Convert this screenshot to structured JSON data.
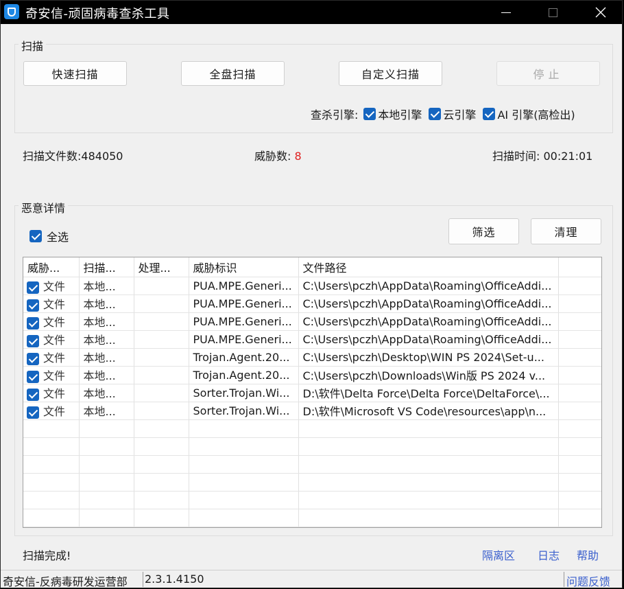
{
  "window": {
    "title": "奇安信-顽固病毒查杀工具",
    "controls": {
      "minimize_icon": "minimize-icon",
      "maximize_icon": "maximize-icon",
      "close_icon": "close-icon"
    }
  },
  "scan_group": {
    "label": "扫描",
    "buttons": {
      "quick": "快速扫描",
      "full": "全盘扫描",
      "custom": "自定义扫描",
      "stop": "停止"
    },
    "engines": {
      "label": "查杀引擎:",
      "local": "本地引擎",
      "cloud": "云引擎",
      "ai": "AI 引擎(高检出)"
    }
  },
  "stats": {
    "files_label": "扫描文件数:",
    "files_value": "484050",
    "threats_label": "威胁数:",
    "threats_value": "8",
    "time_label": "扫描时间:",
    "time_value": "00:21:01"
  },
  "detail_group": {
    "label": "恶意详情",
    "select_all": "全选",
    "filter_button": "筛选",
    "clean_button": "清理"
  },
  "table": {
    "columns": [
      "威胁...",
      "扫描...",
      "处理...",
      "威胁标识",
      "文件路径"
    ],
    "rows": [
      {
        "type": "文件",
        "engine": "本地...",
        "action": "",
        "threat": "PUA.MPE.Generi...",
        "path": "C:\\Users\\pczh\\AppData\\Roaming\\OfficeAddi..."
      },
      {
        "type": "文件",
        "engine": "本地...",
        "action": "",
        "threat": "PUA.MPE.Generi...",
        "path": "C:\\Users\\pczh\\AppData\\Roaming\\OfficeAddi..."
      },
      {
        "type": "文件",
        "engine": "本地...",
        "action": "",
        "threat": "PUA.MPE.Generi...",
        "path": "C:\\Users\\pczh\\AppData\\Roaming\\OfficeAddi..."
      },
      {
        "type": "文件",
        "engine": "本地...",
        "action": "",
        "threat": "PUA.MPE.Generi...",
        "path": "C:\\Users\\pczh\\AppData\\Roaming\\OfficeAddi..."
      },
      {
        "type": "文件",
        "engine": "本地...",
        "action": "",
        "threat": "Trojan.Agent.20...",
        "path": "C:\\Users\\pczh\\Desktop\\WIN PS 2024\\Set-u..."
      },
      {
        "type": "文件",
        "engine": "本地...",
        "action": "",
        "threat": "Trojan.Agent.20...",
        "path": "C:\\Users\\pczh\\Downloads\\Win版 PS 2024 v..."
      },
      {
        "type": "文件",
        "engine": "本地...",
        "action": "",
        "threat": "Sorter.Trojan.Wi...",
        "path": "D:\\软件\\Delta Force\\Delta Force\\DeltaForce\\..."
      },
      {
        "type": "文件",
        "engine": "本地...",
        "action": "",
        "threat": "Sorter.Trojan.Wi...",
        "path": "D:\\软件\\Microsoft VS Code\\resources\\app\\n..."
      }
    ]
  },
  "footer": {
    "status": "扫描完成!",
    "links": {
      "quarantine": "隔离区",
      "log": "日志",
      "help": "帮助"
    }
  },
  "statusbar": {
    "org": "奇安信-反病毒研发运营部",
    "version": "2.3.1.4150",
    "feedback": "问题反馈"
  },
  "colors": {
    "accent": "#1565c0",
    "threat_count": "#e02020",
    "link": "#3a5fcd",
    "title_bg": "#000000"
  }
}
